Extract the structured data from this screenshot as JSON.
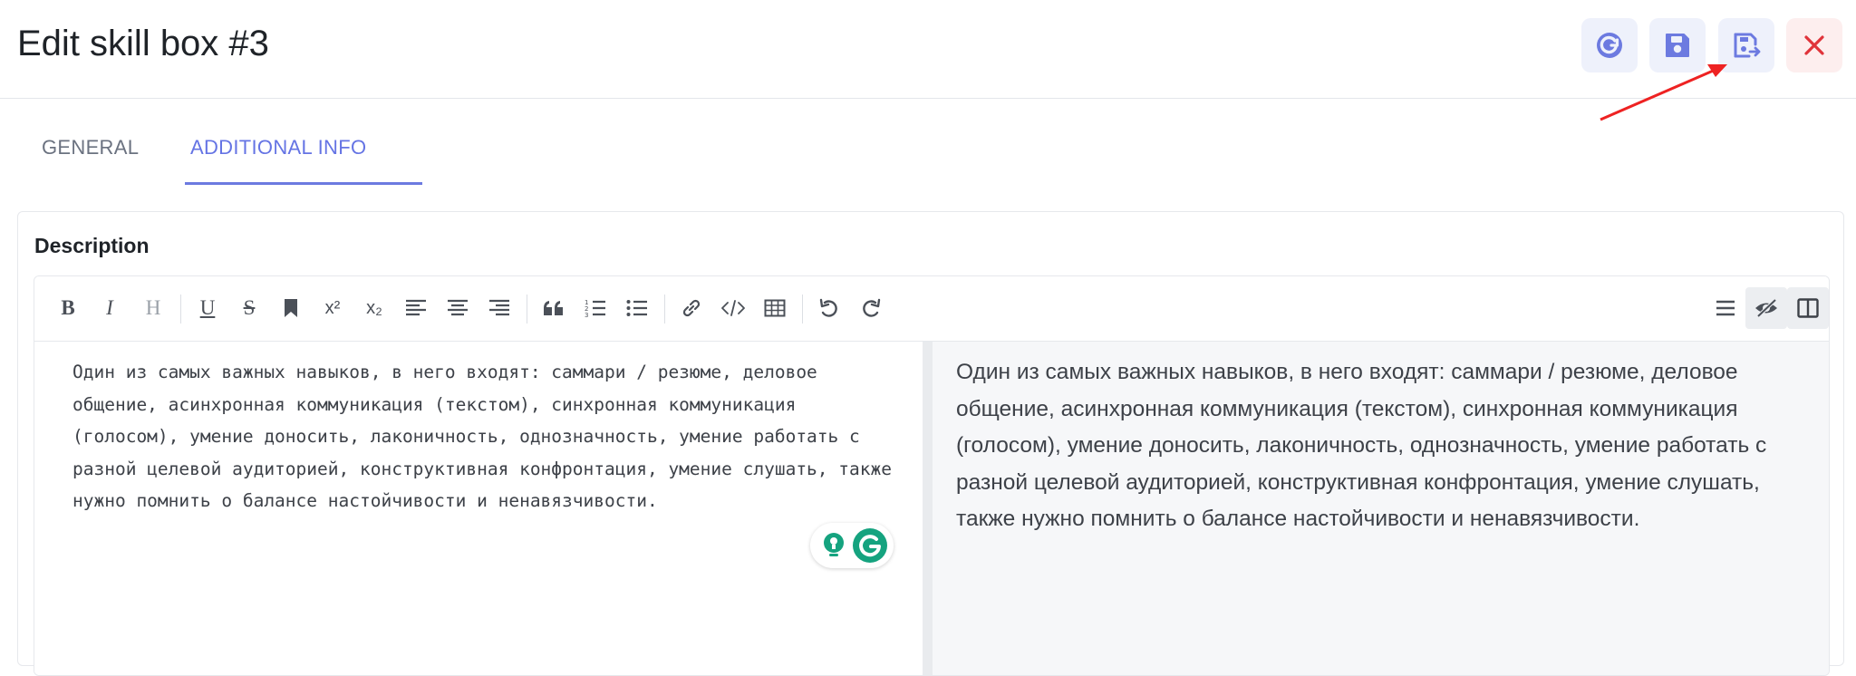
{
  "header": {
    "title": "Edit skill box #3",
    "buttons": [
      {
        "name": "reset-button",
        "icon": "refresh-icon"
      },
      {
        "name": "save-button",
        "icon": "save-icon"
      },
      {
        "name": "save-and-exit-button",
        "icon": "save-exit-icon"
      },
      {
        "name": "close-button",
        "icon": "close-icon"
      }
    ]
  },
  "tabs": [
    {
      "label": "GENERAL",
      "active": false
    },
    {
      "label": "ADDITIONAL INFO",
      "active": true
    }
  ],
  "form": {
    "description_label": "Description",
    "description_text": "Один из самых важных навыков, в него входят: саммари / резюме, деловое общение, асинхронная коммуникация (текстом), синхронная коммуникация (голосом), умение доносить, лаконичность, однозначность, умение работать с разной целевой аудиторией, конструктивная конфронтация, умение слушать, также нужно помнить о балансе настойчивости и ненавязчивости."
  },
  "toolbar": {
    "bold": "B",
    "italic": "I",
    "heading": "H",
    "underline": "U",
    "strike": "S",
    "superscript": "x²",
    "subscript": "x₂"
  },
  "colors": {
    "accent": "#6574e4",
    "header_button_bg": "#eef1fb",
    "close_button_bg": "#fdeeee",
    "close_icon": "#e0333a",
    "annotation_arrow": "#ee2222"
  }
}
